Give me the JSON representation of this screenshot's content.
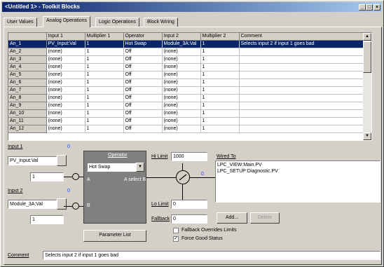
{
  "window": {
    "title": "<Untitled 1> - Toolkit Blocks",
    "min": "_",
    "max": "□",
    "close": "×"
  },
  "tabs": [
    "User Values",
    "Analog Operations",
    "Logic Operations",
    "Block Wiring"
  ],
  "grid": {
    "columns": [
      "",
      "Input 1",
      "Multiplier 1",
      "Operator",
      "Input 2",
      "Multiplier 2",
      "Comment"
    ],
    "rows": [
      [
        "An_1",
        "PV_Input:Val",
        "1",
        "Hot Swap",
        "Module_3A:Val",
        "1",
        "Selects input 2 if input 1 goes bad"
      ],
      [
        "An_2",
        "(none)",
        "1",
        "Off",
        "(none)",
        "1",
        ""
      ],
      [
        "An_3",
        "(none)",
        "1",
        "Off",
        "(none)",
        "1",
        ""
      ],
      [
        "An_4",
        "(none)",
        "1",
        "Off",
        "(none)",
        "1",
        ""
      ],
      [
        "An_5",
        "(none)",
        "1",
        "Off",
        "(none)",
        "1",
        ""
      ],
      [
        "An_6",
        "(none)",
        "1",
        "Off",
        "(none)",
        "1",
        ""
      ],
      [
        "An_7",
        "(none)",
        "1",
        "Off",
        "(none)",
        "1",
        ""
      ],
      [
        "An_8",
        "(none)",
        "1",
        "Off",
        "(none)",
        "1",
        ""
      ],
      [
        "An_9",
        "(none)",
        "1",
        "Off",
        "(none)",
        "1",
        ""
      ],
      [
        "An_10",
        "(none)",
        "1",
        "Off",
        "(none)",
        "1",
        ""
      ],
      [
        "An_11",
        "(none)",
        "1",
        "Off",
        "(none)",
        "1",
        ""
      ],
      [
        "An_12",
        "(none)",
        "1",
        "Off",
        "(none)",
        "1",
        ""
      ]
    ]
  },
  "editor": {
    "input1_label": "Input 1",
    "input1_value": "PV_Input:Val",
    "input1_mult": "1",
    "input1_badge": "0",
    "input2_label": "Input 2",
    "input2_value": "Module_3A:Val",
    "input2_mult": "1",
    "input2_badge": "0",
    "operator_label": "Operator",
    "operator_value": "Hot Swap",
    "a_label": "A",
    "b_label": "B",
    "a_select_label": "A select B",
    "output_badge": "0",
    "param_button": "Parameter List",
    "hi_limit_label": "Hi Limit",
    "hi_limit_value": "1000",
    "lo_limit_label": "Lo Limit",
    "lo_limit_value": "0",
    "fallback_label": "Fallback",
    "fallback_value": "0",
    "wired_to_label": "Wired To",
    "wired_to": [
      "LPC_VIEW:Main.PV",
      "LPC_SETUP:Diagnostic.PV"
    ],
    "add_button": "Add...",
    "delete_button": "Delete",
    "fallback_override_label": "Fallback Overrides Limits",
    "fallback_override_checked": false,
    "force_good_label": "Force Good Status",
    "force_good_checked": true,
    "comment_label": "Comment",
    "comment_value": "Selects input 2 if input 1 goes bad"
  }
}
